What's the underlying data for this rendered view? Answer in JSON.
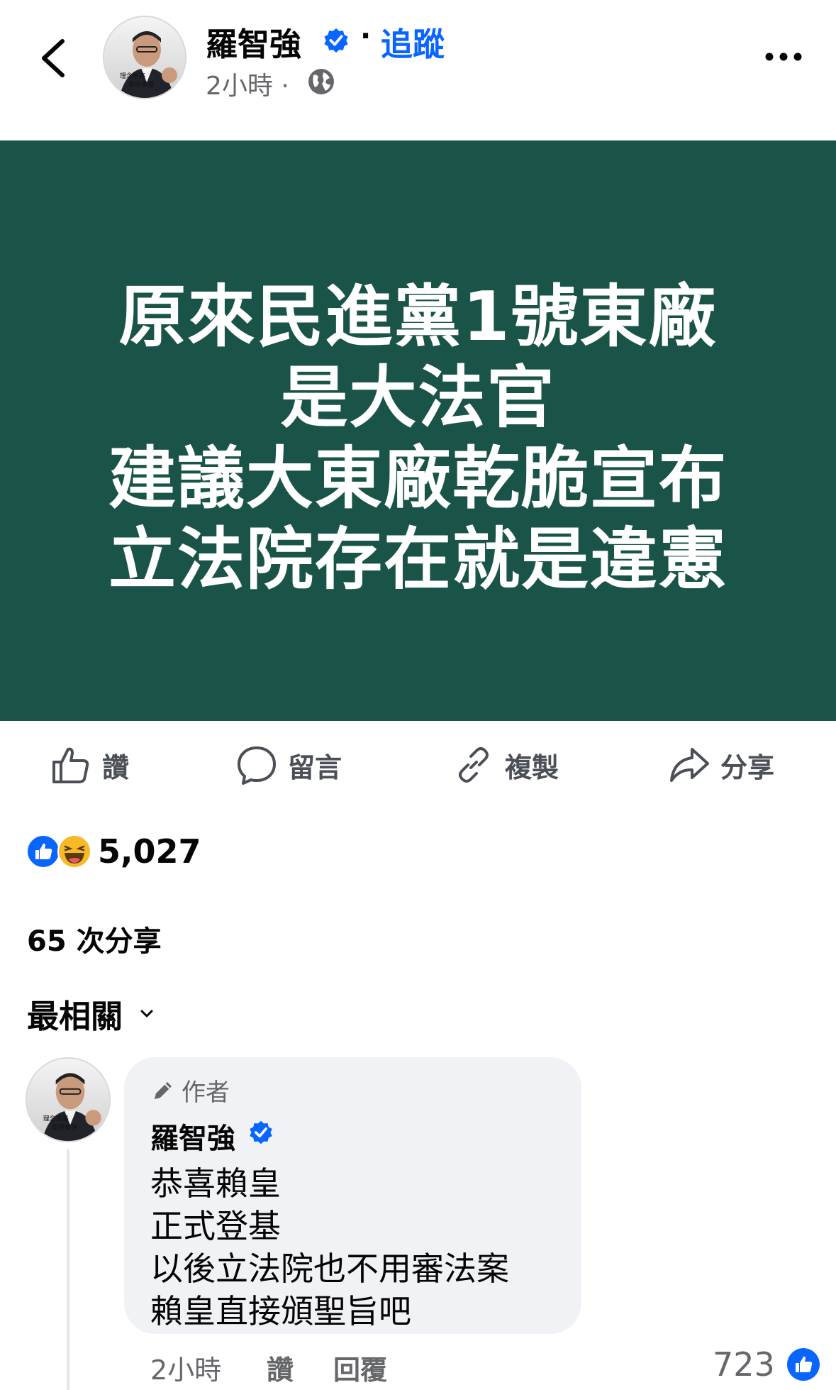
{
  "header": {
    "author_name": "羅智強",
    "follow_label": "追蹤",
    "time": "2小時",
    "separator": "·"
  },
  "post": {
    "banner_lines": [
      "原來民進黨1號東廠",
      "是大法官",
      "建議大東廠乾脆宣布",
      "立法院存在就是違憲"
    ],
    "banner_bg": "#1a5449",
    "avatar_caption": [
      "理念是路",
      "堅持者強"
    ]
  },
  "actions": {
    "like": "讚",
    "comment": "留言",
    "copy": "複製",
    "share": "分享"
  },
  "stats": {
    "reaction_count": "5,027",
    "share_count": "65 次分享"
  },
  "sort": {
    "label": "最相關"
  },
  "comment": {
    "author_tag": "作者",
    "name": "羅智強",
    "lines": [
      "恭喜賴皇",
      "正式登基",
      "以後立法院也不用審法案",
      "賴皇直接頒聖旨吧"
    ],
    "time": "2小時",
    "like_label": "讚",
    "reply_label": "回覆",
    "like_count": "723"
  },
  "colors": {
    "accent": "#0866ff",
    "secondary_text": "#65676b"
  }
}
